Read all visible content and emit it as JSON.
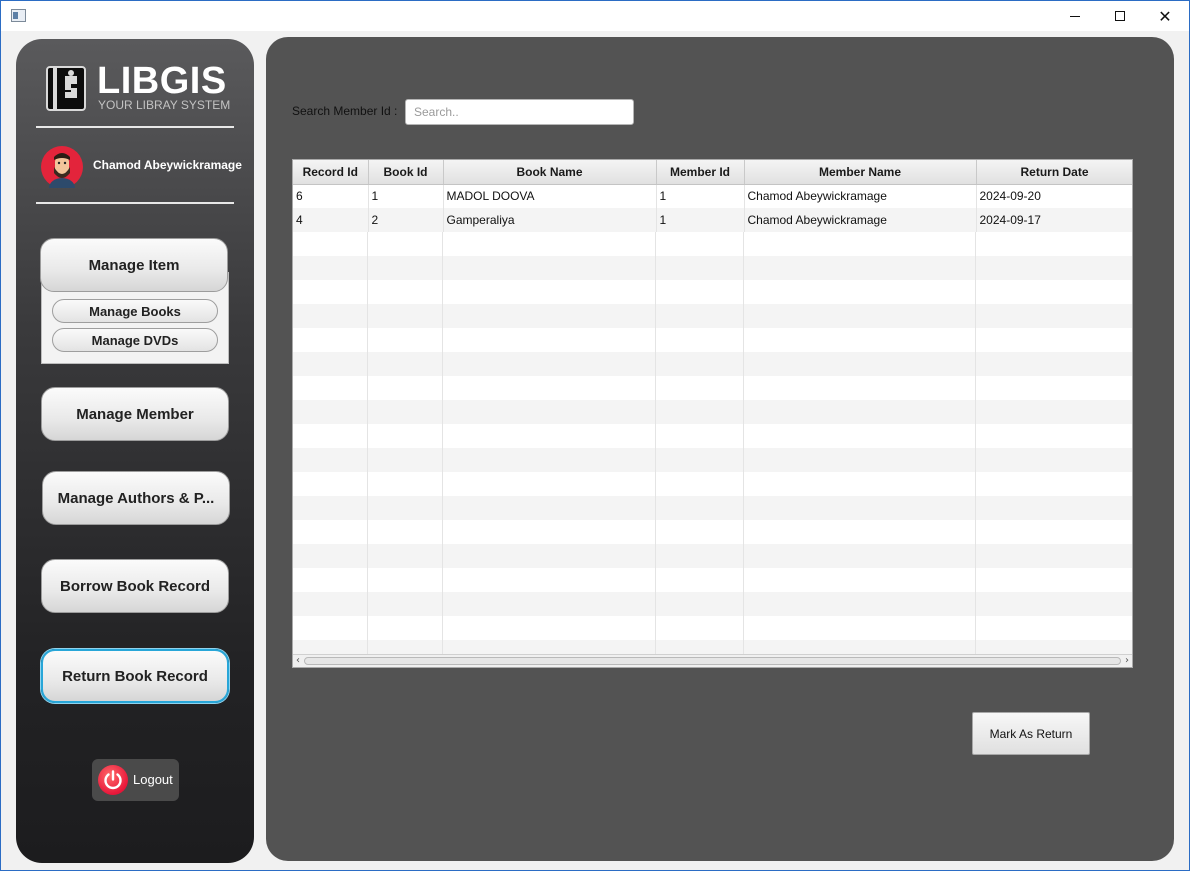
{
  "window": {
    "icons": [
      "app-icon",
      "minimize-icon",
      "maximize-icon",
      "close-icon"
    ],
    "close_glyph": "✕"
  },
  "sidebar": {
    "logo": {
      "title": "LIBGIS",
      "subtitle": "YOUR LIBRAY SYSTEM",
      "icon": "book-logo-icon"
    },
    "user": {
      "name": "Chamod Abeywickramage",
      "avatar": "avatar-icon"
    },
    "manage_item": {
      "label": "Manage Item",
      "sub_items": [
        "Manage Books",
        "Manage DVDs"
      ]
    },
    "buttons": {
      "member": "Manage Member",
      "authors": "Manage Authors & P...",
      "borrow": "Borrow Book Record",
      "return": "Return Book Record"
    },
    "logout": {
      "label": "Logout",
      "icon": "power-icon"
    },
    "active_item": "Return Book Record"
  },
  "main": {
    "search": {
      "label": "Search Member Id :",
      "placeholder": "Search..",
      "value": ""
    },
    "table": {
      "columns": [
        "Record Id",
        "Book Id",
        "Book Name",
        "Member Id",
        "Member Name",
        "Return Date"
      ],
      "rows": [
        [
          "6",
          "1",
          "MADOL DOOVA",
          "1",
          "Chamod Abeywickramage",
          "2024-09-20"
        ],
        [
          "4",
          "2",
          "Gamperaliya",
          "1",
          "Chamod Abeywickramage",
          "2024-09-17"
        ]
      ],
      "scroll_left": "‹",
      "scroll_right": "›"
    },
    "mark_button": "Mark As Return"
  },
  "colors": {
    "accent_focus": "#28a6d8",
    "panel": "#535353",
    "sidebar_dark": "#1c1c1e",
    "logout_red": "#e8173a"
  }
}
